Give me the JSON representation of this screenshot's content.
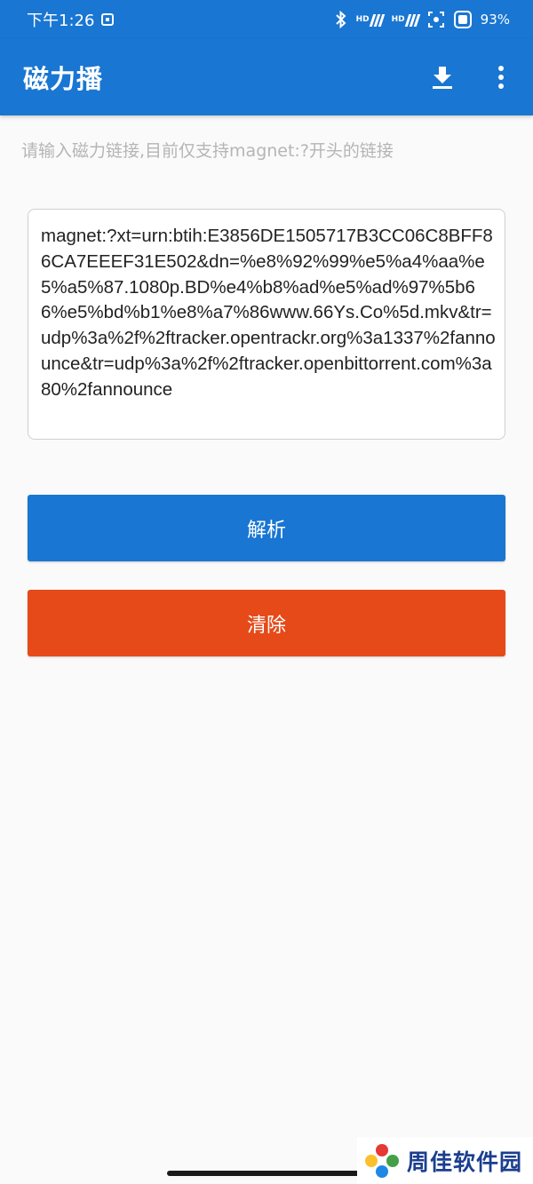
{
  "status_bar": {
    "time": "下午1:26",
    "network_1": "HD",
    "network_2": "HD",
    "battery": "93%"
  },
  "app_bar": {
    "title": "磁力播",
    "icons": [
      "download-icon",
      "more-vert-icon"
    ]
  },
  "input": {
    "hint": "请输入磁力链接,目前仅支持magnet:?开头的链接",
    "value": "magnet:?xt=urn:btih:E3856DE1505717B3CC06C8BFF86CA7EEEF31E502&dn=%e8%92%99%e5%a4%aa%e5%a5%87.1080p.BD%e4%b8%ad%e5%ad%97%5b66%e5%bd%b1%e8%a7%86www.66Ys.Co%5d.mkv&tr=udp%3a%2f%2ftracker.opentrackr.org%3a1337%2fannounce&tr=udp%3a%2f%2ftracker.openbittorrent.com%3a80%2fannounce"
  },
  "buttons": {
    "parse_label": "解析",
    "clear_label": "清除"
  },
  "watermark": {
    "text": "周佳软件园"
  },
  "colors": {
    "primary": "#1976d2",
    "parse_button": "#1976d2",
    "clear_button": "#e64a19",
    "background": "#fafafa"
  }
}
